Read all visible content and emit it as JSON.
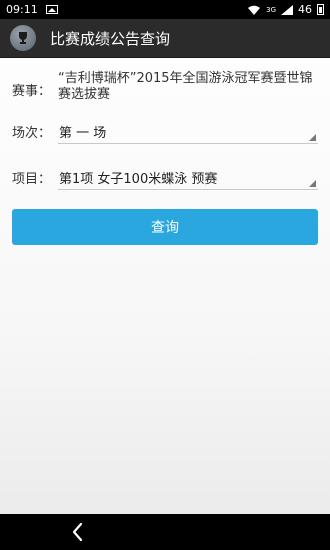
{
  "status_bar": {
    "time": "09:11",
    "network": "46",
    "network_mode": "3G"
  },
  "app_bar": {
    "icon": "trophy-icon",
    "title": "比赛成绩公告查询"
  },
  "form": {
    "event_label": "赛事：",
    "event_value": "“吉利博瑞杯”2015年全国游泳冠军赛暨世锦赛选拔赛",
    "session_label": "场次：",
    "session_value": "第 一 场",
    "item_label": "项目：",
    "item_value": "第1项  女子100米蝶泳  预赛",
    "query_label": "查询"
  },
  "nav_bar": {
    "back_icon": "back-chevron-icon"
  },
  "colors": {
    "accent": "#2aa7df",
    "app_bar": "#2b2b2b"
  }
}
